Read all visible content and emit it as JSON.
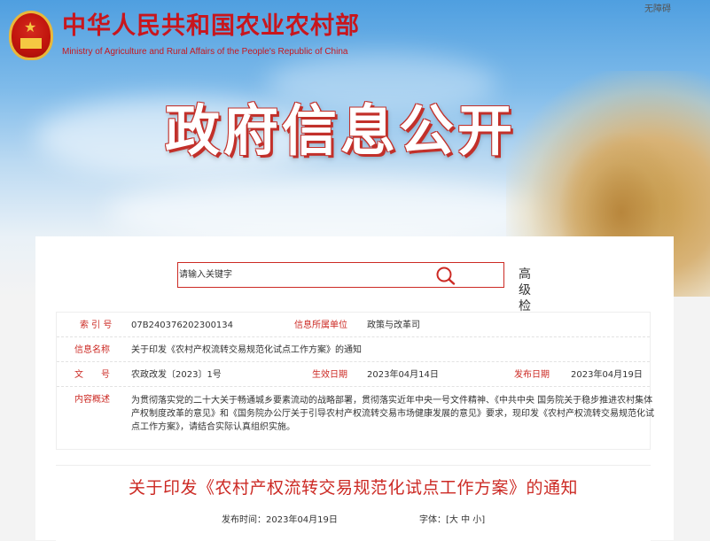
{
  "header": {
    "ministry_cn": "中华人民共和国农业农村部",
    "ministry_en": "Ministry of Agriculture and Rural Affairs of the People's Republic of China",
    "accessibility": "无障碍",
    "page_title": "政府信息公开"
  },
  "search": {
    "placeholder": "请输入关键字",
    "advanced_label": "高级检索",
    "icon": "search-icon"
  },
  "info": {
    "index_label": "索 引 号",
    "index_value": "07B240376202300134",
    "dept_label": "信息所属单位",
    "dept_value": "政策与改革司",
    "name_label": "信息名称",
    "name_value": "关于印发《农村产权流转交易规范化试点工作方案》的通知",
    "doc_label": "文　　号",
    "doc_value": "农政改发〔2023〕1号",
    "effective_label": "生效日期",
    "effective_value": "2023年04月14日",
    "publish_label": "发布日期",
    "publish_value": "2023年04月19日",
    "summary_label": "内容概述",
    "summary_value": "为贯彻落实党的二十大关于畅通城乡要素流动的战略部署，贯彻落实近年中央一号文件精神、《中共中央 国务院关于稳步推进农村集体产权制度改革的意见》和《国务院办公厅关于引导农村产权流转交易市场健康发展的意见》要求，现印发《农村产权流转交易规范化试点工作方案》，请结合实际认真组织实施。"
  },
  "article": {
    "title": "关于印发《农村产权流转交易规范化试点工作方案》的通知",
    "publish_time": "发布时间：2023年04月19日",
    "font_label": "字体：[",
    "font_large": "大",
    "font_medium": "中",
    "font_small": "小",
    "font_close": "]"
  },
  "colors": {
    "accent_red": "#cc2a24",
    "text": "#333333"
  }
}
